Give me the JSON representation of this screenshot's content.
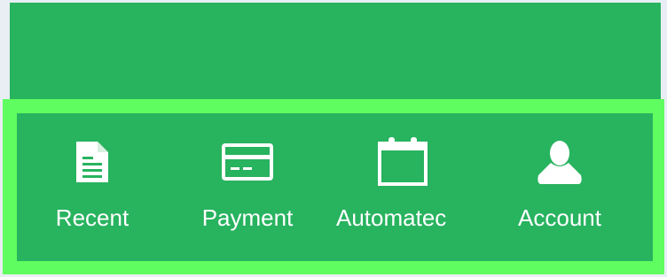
{
  "colors": {
    "page_background": "#e9eef5",
    "panel": "#28b35f",
    "highlight_frame": "#5ffd5f",
    "icon_and_text": "#ffffff"
  },
  "tabbar": {
    "tabs": [
      {
        "label": "Recent",
        "icon": "document-icon"
      },
      {
        "label": "Payment",
        "icon": "credit-card-icon"
      },
      {
        "label": "Automatec",
        "icon": "calendar-icon"
      },
      {
        "label": "Account",
        "icon": "user-icon"
      }
    ]
  }
}
